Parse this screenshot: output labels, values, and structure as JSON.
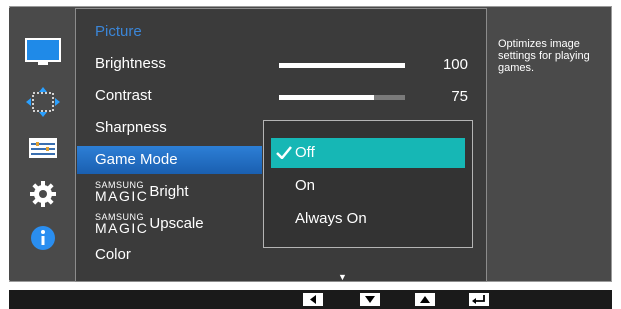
{
  "menu": {
    "header": "Picture",
    "items": [
      {
        "label": "Brightness"
      },
      {
        "label": "Contrast"
      },
      {
        "label": "Sharpness"
      },
      {
        "label": "Game Mode"
      },
      {
        "prefix_small": "SAMSUNG",
        "prefix_big": "MAGIC",
        "label": "Bright"
      },
      {
        "prefix_small": "SAMSUNG",
        "prefix_big": "MAGIC",
        "label": "Upscale"
      },
      {
        "label": "Color"
      }
    ]
  },
  "sliders": {
    "brightness": {
      "value": "100",
      "fraction": 1.0
    },
    "contrast": {
      "value": "75",
      "fraction": 0.75
    }
  },
  "game_mode_options": {
    "options": [
      "Off",
      "On",
      "Always On"
    ],
    "selected": "Off"
  },
  "description": "Optimizes image settings for playing games.",
  "icons": [
    "monitor-icon",
    "resize-icon",
    "settings-panel-icon",
    "gear-icon",
    "info-icon"
  ],
  "nav_keys": [
    "left-arrow-icon",
    "down-arrow-icon",
    "up-arrow-icon",
    "enter-icon"
  ],
  "colors": {
    "header": "#3b86d8",
    "selected_item": "#1f6fc6",
    "active_option": "#16b7b5"
  }
}
